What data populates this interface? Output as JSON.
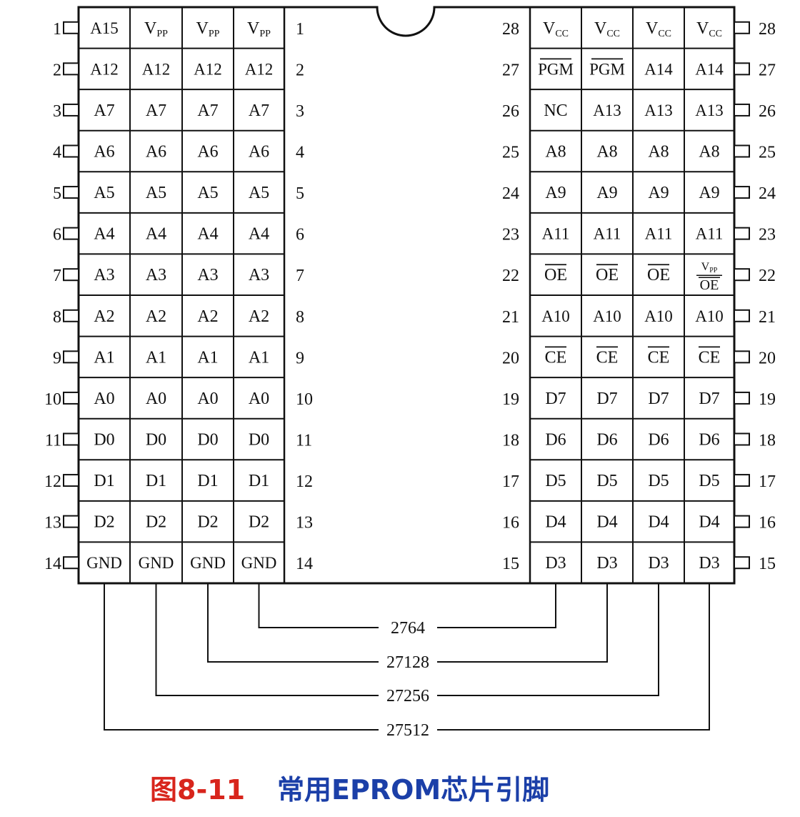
{
  "left_pins": [
    {
      "pin": "1",
      "signals": [
        "A15",
        "VPP",
        "VPP",
        "VPP"
      ]
    },
    {
      "pin": "2",
      "signals": [
        "A12",
        "A12",
        "A12",
        "A12"
      ]
    },
    {
      "pin": "3",
      "signals": [
        "A7",
        "A7",
        "A7",
        "A7"
      ]
    },
    {
      "pin": "4",
      "signals": [
        "A6",
        "A6",
        "A6",
        "A6"
      ]
    },
    {
      "pin": "5",
      "signals": [
        "A5",
        "A5",
        "A5",
        "A5"
      ]
    },
    {
      "pin": "6",
      "signals": [
        "A4",
        "A4",
        "A4",
        "A4"
      ]
    },
    {
      "pin": "7",
      "signals": [
        "A3",
        "A3",
        "A3",
        "A3"
      ]
    },
    {
      "pin": "8",
      "signals": [
        "A2",
        "A2",
        "A2",
        "A2"
      ]
    },
    {
      "pin": "9",
      "signals": [
        "A1",
        "A1",
        "A1",
        "A1"
      ]
    },
    {
      "pin": "10",
      "signals": [
        "A0",
        "A0",
        "A0",
        "A0"
      ]
    },
    {
      "pin": "11",
      "signals": [
        "D0",
        "D0",
        "D0",
        "D0"
      ]
    },
    {
      "pin": "12",
      "signals": [
        "D1",
        "D1",
        "D1",
        "D1"
      ]
    },
    {
      "pin": "13",
      "signals": [
        "D2",
        "D2",
        "D2",
        "D2"
      ]
    },
    {
      "pin": "14",
      "signals": [
        "GND",
        "GND",
        "GND",
        "GND"
      ]
    }
  ],
  "right_pins": [
    {
      "pin": "28",
      "signals": [
        "VCC",
        "VCC",
        "VCC",
        "VCC"
      ]
    },
    {
      "pin": "27",
      "signals": [
        "PGM",
        "PGM",
        "A14",
        "A14"
      ]
    },
    {
      "pin": "26",
      "signals": [
        "NC",
        "A13",
        "A13",
        "A13"
      ]
    },
    {
      "pin": "25",
      "signals": [
        "A8",
        "A8",
        "A8",
        "A8"
      ]
    },
    {
      "pin": "24",
      "signals": [
        "A9",
        "A9",
        "A9",
        "A9"
      ]
    },
    {
      "pin": "23",
      "signals": [
        "A11",
        "A11",
        "A11",
        "A11"
      ]
    },
    {
      "pin": "22",
      "signals": [
        "OE",
        "OE",
        "OE",
        "VPP/OE"
      ]
    },
    {
      "pin": "21",
      "signals": [
        "A10",
        "A10",
        "A10",
        "A10"
      ]
    },
    {
      "pin": "20",
      "signals": [
        "CE",
        "CE",
        "CE",
        "CE"
      ]
    },
    {
      "pin": "19",
      "signals": [
        "D7",
        "D7",
        "D7",
        "D7"
      ]
    },
    {
      "pin": "18",
      "signals": [
        "D6",
        "D6",
        "D6",
        "D6"
      ]
    },
    {
      "pin": "17",
      "signals": [
        "D5",
        "D5",
        "D5",
        "D5"
      ]
    },
    {
      "pin": "16",
      "signals": [
        "D4",
        "D4",
        "D4",
        "D4"
      ]
    },
    {
      "pin": "15",
      "signals": [
        "D3",
        "D3",
        "D3",
        "D3"
      ]
    }
  ],
  "chips": [
    "2764",
    "27128",
    "27256",
    "27512"
  ],
  "caption": {
    "number": "图8-11",
    "text": "常用EPROM芯片引脚"
  }
}
